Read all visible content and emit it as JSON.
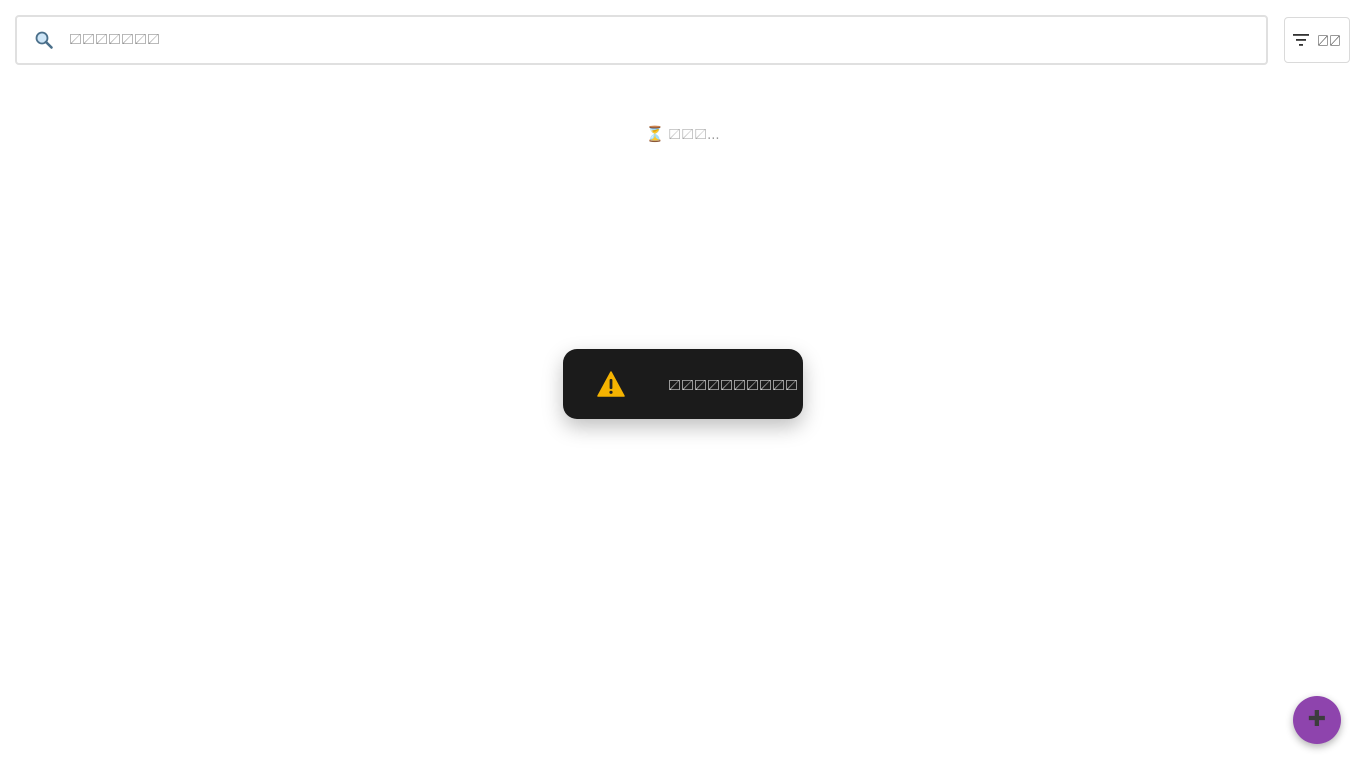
{
  "search": {
    "placeholder": "〼〼〼〼〼〼〼",
    "value": "",
    "icon": "search-icon"
  },
  "filter": {
    "label": "〼〼",
    "icon": "filter-icon"
  },
  "loading": {
    "icon": "hourglass-icon",
    "icon_glyph": "⏳",
    "text": "〼〼〼..."
  },
  "toast": {
    "icon": "warning-icon",
    "text": "〼〼〼〼〼〼〼〼〼〼"
  },
  "fab": {
    "icon": "plus-icon",
    "glyph": "✚"
  },
  "colors": {
    "fab_background": "#8e44ad",
    "toast_background": "#1b1b1b",
    "warning": "#f5b301"
  }
}
